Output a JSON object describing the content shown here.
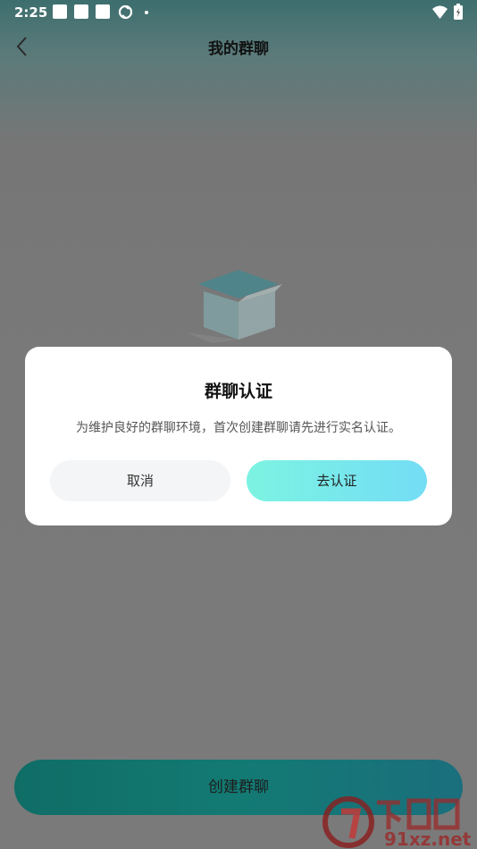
{
  "status_bar": {
    "time": "2:25"
  },
  "header": {
    "title": "我的群聊",
    "back_icon": "chevron-left-icon"
  },
  "main": {
    "empty_illustration": "empty-box-icon",
    "create_button_label": "创建群聊"
  },
  "dialog": {
    "title": "群聊认证",
    "message": "为维护良好的群聊环境，首次创建群聊请先进行实名认证。",
    "cancel_label": "取消",
    "confirm_label": "去认证"
  },
  "watermark": {
    "brand": "下载站",
    "domain": "91xz.net"
  },
  "colors": {
    "accent_gradient_start": "#7df3e2",
    "accent_gradient_end": "#73ddf5",
    "create_button": "#137a73"
  }
}
